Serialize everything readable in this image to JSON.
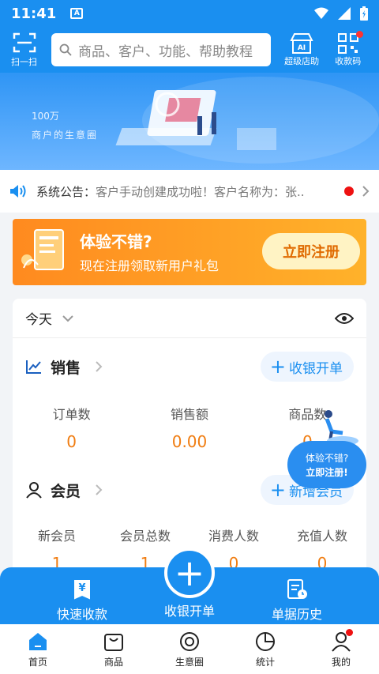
{
  "status_bar": {
    "time": "11:41",
    "app_indicator": "A"
  },
  "top_bar": {
    "scan_label": "扫一扫",
    "search_placeholder": "商品、客户、功能、帮助教程",
    "ai_store_label": "超级店助",
    "ai_badge": "AI",
    "pay_code_label": "收款码"
  },
  "banner": {
    "line1": "100万",
    "line2": "商户的生意圈"
  },
  "notice": {
    "label": "系统公告：",
    "text": "客户手动创建成功啦！客户名称为：张..."
  },
  "promo": {
    "title": "体验不错?",
    "subtitle": "现在注册领取新用户礼包",
    "button": "立即注册"
  },
  "card": {
    "date": "今天",
    "sales": {
      "title": "销售",
      "action": "收银开单",
      "stats": [
        {
          "label": "订单数",
          "value": "0"
        },
        {
          "label": "销售额",
          "value": "0.00"
        },
        {
          "label": "商品数",
          "value": "0"
        }
      ]
    },
    "members": {
      "title": "会员",
      "action": "新增会员",
      "stats": [
        {
          "label": "新会员",
          "value": "1"
        },
        {
          "label": "会员总数",
          "value": "1"
        },
        {
          "label": "消费人数",
          "value": "0"
        },
        {
          "label": "充值人数",
          "value": "0"
        }
      ]
    }
  },
  "float_promo": {
    "line1": "体验不错?",
    "line2": "立即注册!"
  },
  "action_bar": {
    "quick_pay": "快速收款",
    "cashier": "收银开单",
    "history": "单据历史"
  },
  "tabs": [
    {
      "label": "首页",
      "icon": "home-icon"
    },
    {
      "label": "商品",
      "icon": "bag-icon"
    },
    {
      "label": "生意圈",
      "icon": "circle-icon"
    },
    {
      "label": "统计",
      "icon": "pie-icon"
    },
    {
      "label": "我的",
      "icon": "user-icon"
    }
  ],
  "colors": {
    "primary": "#1a8ff0",
    "orange": "#f07d12",
    "promo": "#ff9a24"
  }
}
